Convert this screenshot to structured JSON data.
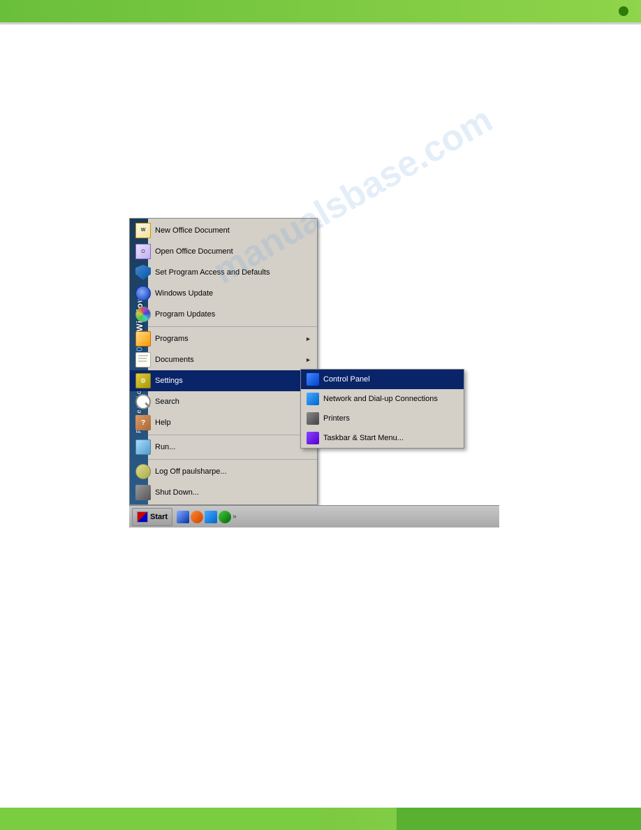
{
  "page": {
    "background_color": "#ffffff"
  },
  "top_bar": {
    "color": "#6abf3a"
  },
  "bottom_bar": {
    "color": "#6abf3a"
  },
  "watermark": {
    "text": "manualsbase.com"
  },
  "start_menu": {
    "sidebar_text_windows": "Windows",
    "sidebar_text_2000": "2000",
    "sidebar_text_professional": "Professional",
    "top_items": [
      {
        "label": "New Office Document",
        "icon": "office-new-icon"
      },
      {
        "label": "Open Office Document",
        "icon": "office-open-icon"
      },
      {
        "label": "Set Program Access and Defaults",
        "icon": "shield-icon"
      },
      {
        "label": "Windows Update",
        "icon": "globe-icon"
      },
      {
        "label": "Program Updates",
        "icon": "cd-icon"
      }
    ],
    "bottom_items": [
      {
        "label": "Programs",
        "icon": "programs-icon",
        "has_arrow": true
      },
      {
        "label": "Documents",
        "icon": "docs-icon",
        "has_arrow": true
      },
      {
        "label": "Settings",
        "icon": "settings-icon",
        "has_arrow": true,
        "active": true
      },
      {
        "label": "Search",
        "icon": "search-icon"
      },
      {
        "label": "Help",
        "icon": "help-icon"
      },
      {
        "label": "Run...",
        "icon": "run-icon"
      },
      {
        "label": "Log Off paulsharpe...",
        "icon": "logoff-icon"
      },
      {
        "label": "Shut Down...",
        "icon": "shutdown-icon"
      }
    ]
  },
  "settings_submenu": {
    "items": [
      {
        "label": "Control Panel",
        "icon": "control-panel-icon",
        "selected": true
      },
      {
        "label": "Network and Dial-up Connections",
        "icon": "network-icon"
      },
      {
        "label": "Printers",
        "icon": "printers-icon"
      },
      {
        "label": "Taskbar & Start Menu...",
        "icon": "taskbar-menu-icon"
      }
    ]
  },
  "taskbar": {
    "start_button_label": "Start"
  }
}
